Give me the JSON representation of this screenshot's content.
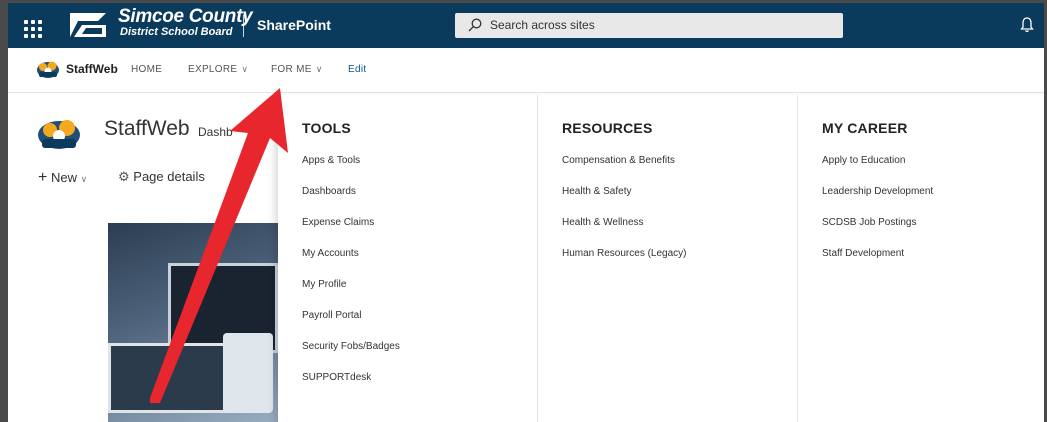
{
  "suitebar": {
    "org_name": "Simcoe County",
    "org_sub": "District School Board",
    "app_name": "SharePoint",
    "search_placeholder": "Search across sites",
    "bg_color": "#0b3b5c"
  },
  "sitenav": {
    "site_title": "StaffWeb",
    "links": [
      {
        "label": "HOME"
      },
      {
        "label": "EXPLORE"
      },
      {
        "label": "FOR ME"
      },
      {
        "label": "Edit"
      }
    ]
  },
  "page": {
    "title": "StaffWeb",
    "dash_partial": "Dashb",
    "cmd_new": "New",
    "cmd_details": "Page details"
  },
  "mega_menu": {
    "columns": [
      {
        "heading": "TOOLS",
        "items": [
          "Apps & Tools",
          "Dashboards",
          "Expense Claims",
          "My Accounts",
          "My Profile",
          "Payroll Portal",
          "Security Fobs/Badges",
          "SUPPORTdesk"
        ]
      },
      {
        "heading": "RESOURCES",
        "items": [
          "Compensation & Benefits",
          "Health & Safety",
          "Health & Wellness",
          "Human Resources (Legacy)"
        ]
      },
      {
        "heading": "MY CAREER",
        "items": [
          "Apply to Education",
          "Leadership Development",
          "SCDSB Job Postings",
          "Staff Development"
        ]
      }
    ]
  },
  "icons": {
    "waffle": "app-launcher-icon",
    "search": "search-icon",
    "bell": "notification-bell-icon",
    "arrow": "red-annotation-arrow"
  },
  "annotation_color": "#e8262d"
}
